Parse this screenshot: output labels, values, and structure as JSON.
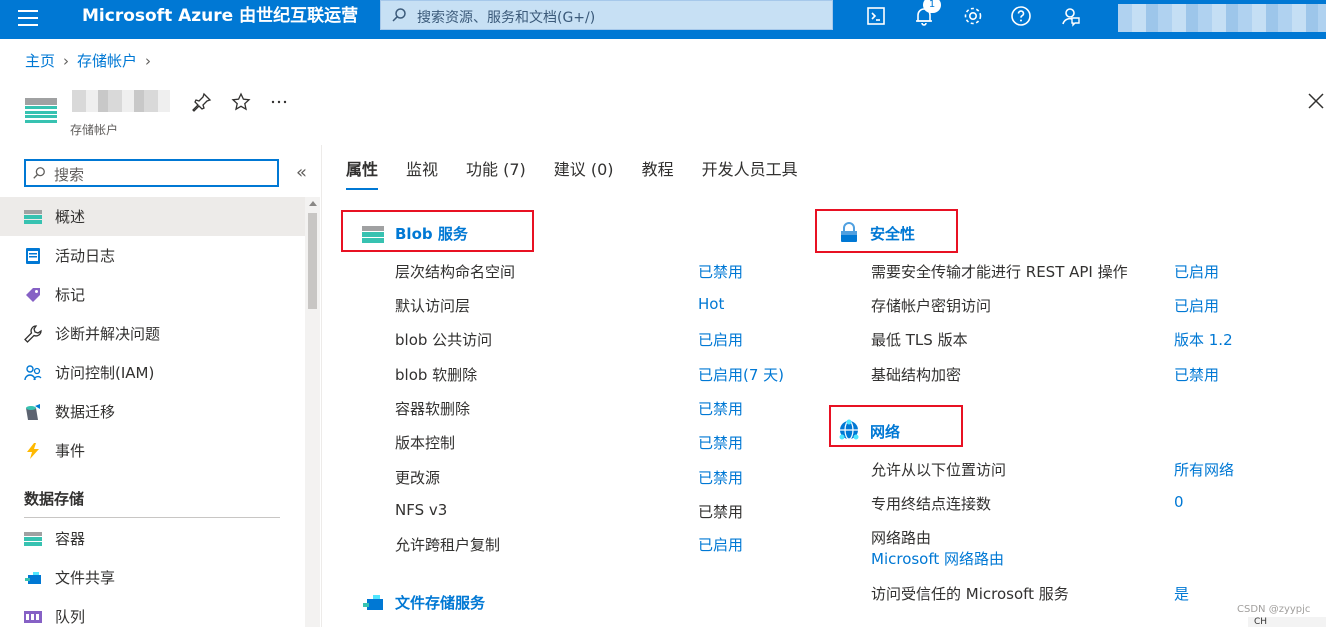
{
  "topbar": {
    "brand": "Microsoft Azure 由世纪互联运营",
    "search_placeholder": "搜索资源、服务和文档(G+/)",
    "notification_count": "1"
  },
  "breadcrumb": {
    "home": "主页",
    "parent": "存储帐户"
  },
  "resource": {
    "type_label": "存储帐户"
  },
  "nav": {
    "search_placeholder": "搜索",
    "collapse": "«",
    "items": [
      {
        "label": "概述",
        "icon": "storage-icon"
      },
      {
        "label": "活动日志",
        "icon": "activity-log-icon"
      },
      {
        "label": "标记",
        "icon": "tag-icon"
      },
      {
        "label": "诊断并解决问题",
        "icon": "wrench-icon"
      },
      {
        "label": "访问控制(IAM)",
        "icon": "people-icon"
      },
      {
        "label": "数据迁移",
        "icon": "data-migration-icon"
      },
      {
        "label": "事件",
        "icon": "lightning-icon"
      }
    ],
    "group_title": "数据存储",
    "group_items": [
      {
        "label": "容器",
        "icon": "container-icon"
      },
      {
        "label": "文件共享",
        "icon": "file-share-icon"
      },
      {
        "label": "队列",
        "icon": "queue-icon"
      }
    ]
  },
  "tabs": [
    "属性",
    "监视",
    "功能 (7)",
    "建议 (0)",
    "教程",
    "开发人员工具"
  ],
  "blob": {
    "title": "Blob 服务",
    "rows": [
      {
        "label": "层次结构命名空间",
        "value": "已禁用",
        "link": true
      },
      {
        "label": "默认访问层",
        "value": "Hot",
        "link": true
      },
      {
        "label": "blob 公共访问",
        "value": "已启用",
        "link": true
      },
      {
        "label": "blob 软删除",
        "value": "已启用(7 天)",
        "link": true
      },
      {
        "label": "容器软删除",
        "value": "已禁用",
        "link": true
      },
      {
        "label": "版本控制",
        "value": "已禁用",
        "link": true
      },
      {
        "label": "更改源",
        "value": "已禁用",
        "link": true
      },
      {
        "label": "NFS v3",
        "value": "已禁用",
        "link": false
      },
      {
        "label": "允许跨租户复制",
        "value": "已启用",
        "link": true
      }
    ]
  },
  "file_service": {
    "title": "文件存储服务"
  },
  "security": {
    "title": "安全性",
    "rows": [
      {
        "label": "需要安全传输才能进行 REST API 操作",
        "value": "已启用"
      },
      {
        "label": "存储帐户密钥访问",
        "value": "已启用"
      },
      {
        "label": "最低 TLS 版本",
        "value": "版本 1.2"
      },
      {
        "label": "基础结构加密",
        "value": "已禁用"
      }
    ]
  },
  "network": {
    "title": "网络",
    "rows": [
      {
        "label": "允许从以下位置访问",
        "value": "所有网络"
      },
      {
        "label": "专用终结点连接数",
        "value": "0"
      }
    ],
    "routing_label": "网络路由",
    "routing_link": "Microsoft 网络路由",
    "trusted_label": "访问受信任的 Microsoft 服务",
    "trusted_value": "是"
  },
  "watermark": "CSDN @zyypjc",
  "taskbar_text": "CH",
  "colors": {
    "accent": "#0078d4",
    "highlight_box": "#e81123"
  }
}
